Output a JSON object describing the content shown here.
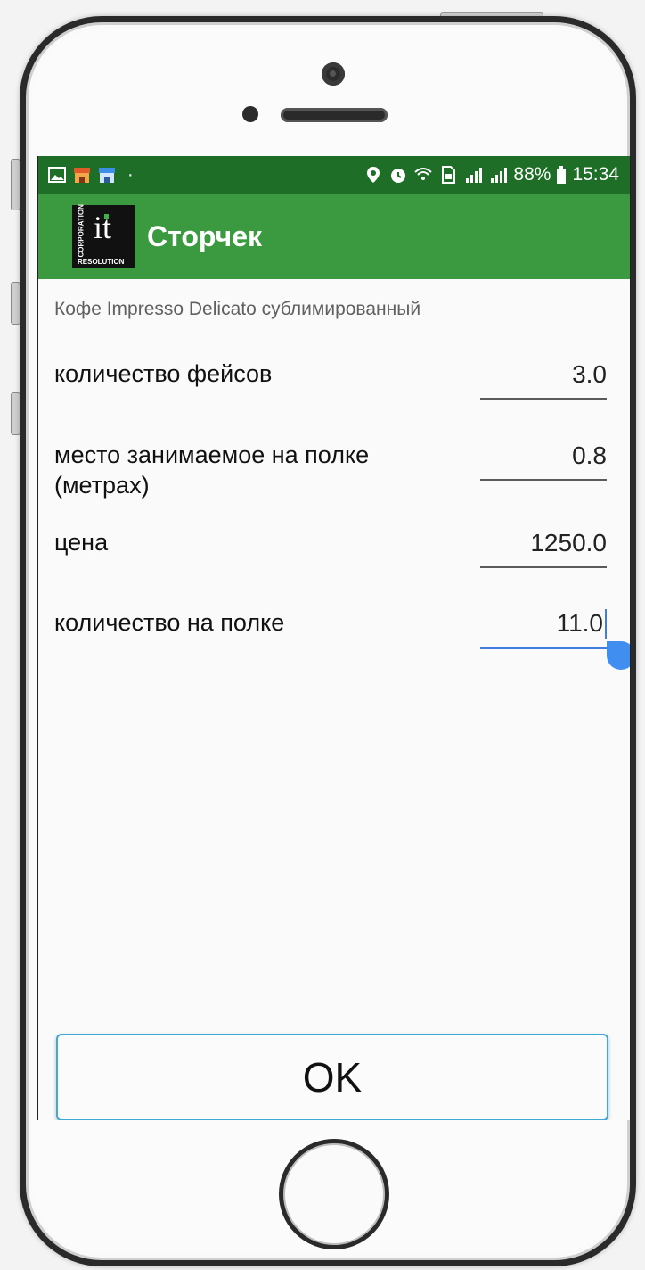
{
  "status_bar": {
    "battery": "88%",
    "time": "15:34",
    "icons": [
      "gallery-icon",
      "store-icon",
      "store-icon",
      "location-icon",
      "alarm-icon",
      "wifi-icon",
      "sim-icon",
      "signal-icon",
      "signal-icon",
      "battery-icon"
    ]
  },
  "app_bar": {
    "title": "Сторчек",
    "logo": {
      "text": "it",
      "side_text": "CORPORATION",
      "bottom_text": "RESOLUTION"
    }
  },
  "product": {
    "name": "Кофе Impresso Delicato сублимированный"
  },
  "fields": [
    {
      "label": "количество фейсов",
      "value": "3.0"
    },
    {
      "label": "место занимаемое на полке (метрах)",
      "value": "0.8"
    },
    {
      "label": "цена",
      "value": "1250.0"
    },
    {
      "label": "количество на полке",
      "value": "11.0"
    }
  ],
  "ok_button": {
    "label": "OK"
  },
  "colors": {
    "status_bar": "#1e6e27",
    "app_bar": "#3b9a40",
    "accent": "#3f7de0",
    "button_border": "#41a9d6"
  }
}
